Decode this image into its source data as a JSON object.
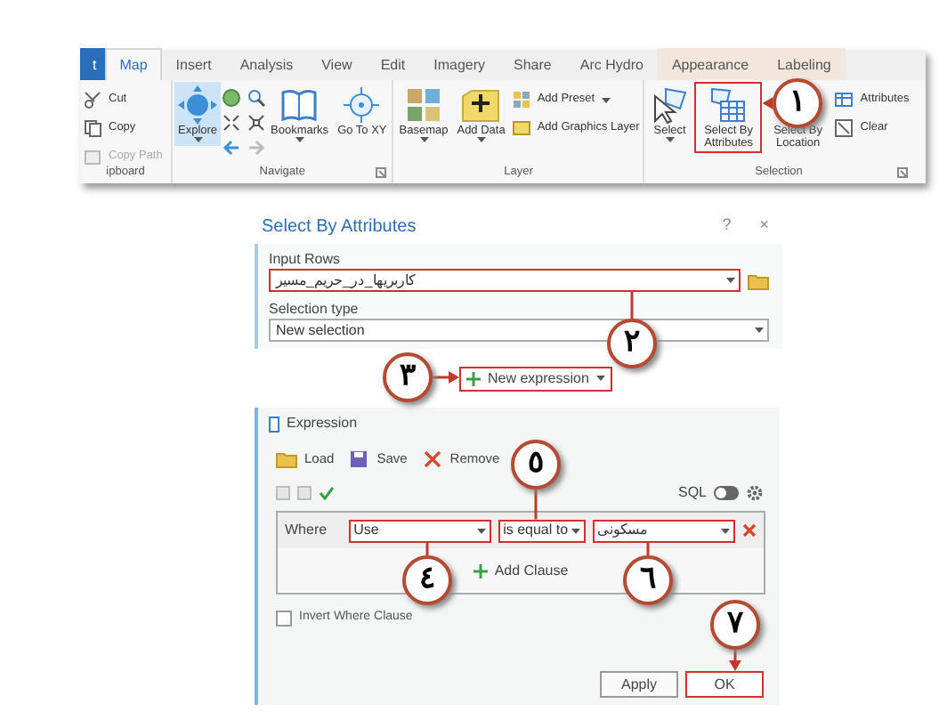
{
  "ribbon": {
    "tabs": [
      {
        "label": "t",
        "kind": "file",
        "selected": false
      },
      {
        "label": "Map",
        "kind": "tab",
        "selected": true
      },
      {
        "label": "Insert",
        "kind": "tab",
        "selected": false
      },
      {
        "label": "Analysis",
        "kind": "tab",
        "selected": false
      },
      {
        "label": "View",
        "kind": "tab",
        "selected": false
      },
      {
        "label": "Edit",
        "kind": "tab",
        "selected": false
      },
      {
        "label": "Imagery",
        "kind": "tab",
        "selected": false
      },
      {
        "label": "Share",
        "kind": "tab",
        "selected": false
      },
      {
        "label": "Arc Hydro",
        "kind": "tab",
        "selected": false
      },
      {
        "label": "Appearance",
        "kind": "contextual",
        "selected": false
      },
      {
        "label": "Labeling",
        "kind": "contextual",
        "selected": false
      }
    ],
    "groups": [
      {
        "label": "ipboard",
        "launcher": false,
        "items": [
          {
            "kind": "small",
            "label": "Cut",
            "selected": false,
            "disabled": false,
            "dropdown": false,
            "highlighted": false
          },
          {
            "kind": "small",
            "label": "Copy",
            "selected": false,
            "disabled": false,
            "dropdown": false,
            "highlighted": false
          },
          {
            "kind": "small",
            "label": "Copy Path",
            "selected": false,
            "disabled": true,
            "dropdown": false,
            "highlighted": false
          }
        ]
      },
      {
        "label": "Navigate",
        "launcher": true,
        "items": [
          {
            "kind": "large",
            "label": "Explore",
            "selected": true,
            "disabled": false,
            "dropdown": true,
            "highlighted": false
          },
          {
            "kind": "tools"
          },
          {
            "kind": "large",
            "label": "Bookmarks",
            "selected": false,
            "disabled": false,
            "dropdown": true,
            "highlighted": false
          },
          {
            "kind": "large",
            "label": "Go To XY",
            "selected": false,
            "disabled": false,
            "dropdown": false,
            "highlighted": false
          }
        ]
      },
      {
        "label": "Layer",
        "launcher": false,
        "items": [
          {
            "kind": "large",
            "label": "Basemap",
            "selected": false,
            "disabled": false,
            "dropdown": true,
            "highlighted": false
          },
          {
            "kind": "large",
            "label": "Add Data",
            "selected": false,
            "disabled": false,
            "dropdown": true,
            "highlighted": false
          },
          {
            "kind": "small",
            "label": "Add Preset",
            "selected": false,
            "disabled": false,
            "dropdown": true,
            "highlighted": false
          },
          {
            "kind": "small",
            "label": "Add Graphics Layer",
            "selected": false,
            "disabled": false,
            "dropdown": false,
            "highlighted": false
          }
        ]
      },
      {
        "label": "Selection",
        "launcher": true,
        "items": [
          {
            "kind": "large",
            "label": "Select",
            "selected": false,
            "disabled": false,
            "dropdown": true,
            "highlighted": false
          },
          {
            "kind": "large",
            "label": "Select By Attributes",
            "selected": false,
            "disabled": false,
            "dropdown": false,
            "highlighted": true
          },
          {
            "kind": "large",
            "label": "Select By Location",
            "selected": false,
            "disabled": false,
            "dropdown": false,
            "highlighted": false
          },
          {
            "kind": "small",
            "label": "Attributes",
            "selected": false,
            "disabled": false,
            "dropdown": false,
            "highlighted": false
          },
          {
            "kind": "small",
            "label": "Clear",
            "selected": false,
            "disabled": false,
            "dropdown": false,
            "highlighted": false
          }
        ]
      }
    ]
  },
  "dialog": {
    "title": "Select By Attributes",
    "help": "?",
    "close": "×",
    "input_rows": {
      "label": "Input Rows",
      "value": "کاربریها_در_حریم_مسیر",
      "highlighted": true
    },
    "selection_type": {
      "label": "Selection type",
      "value": "New selection",
      "highlighted": false
    },
    "new_expression": {
      "label": "New expression",
      "highlighted": true
    },
    "expression": {
      "title": "Expression",
      "toolbar": [
        {
          "label": "Load"
        },
        {
          "label": "Save"
        },
        {
          "label": "Remove"
        }
      ],
      "sql_label": "SQL",
      "sql_on": false,
      "clauses": [
        {
          "connector": "Where",
          "field": "Use",
          "operator": "is equal to",
          "value": "مسکونی",
          "highlighted": true
        }
      ],
      "add_clause": "Add Clause",
      "invert": {
        "label": "Invert Where Clause",
        "checked": false
      }
    },
    "buttons": [
      {
        "label": "Apply",
        "highlighted": false
      },
      {
        "label": "OK",
        "highlighted": true
      }
    ]
  },
  "callouts": [
    {
      "label": "١"
    },
    {
      "label": "٢"
    },
    {
      "label": "٣"
    },
    {
      "label": "٥"
    },
    {
      "label": "٤"
    },
    {
      "label": "٦"
    },
    {
      "label": "٧"
    }
  ]
}
